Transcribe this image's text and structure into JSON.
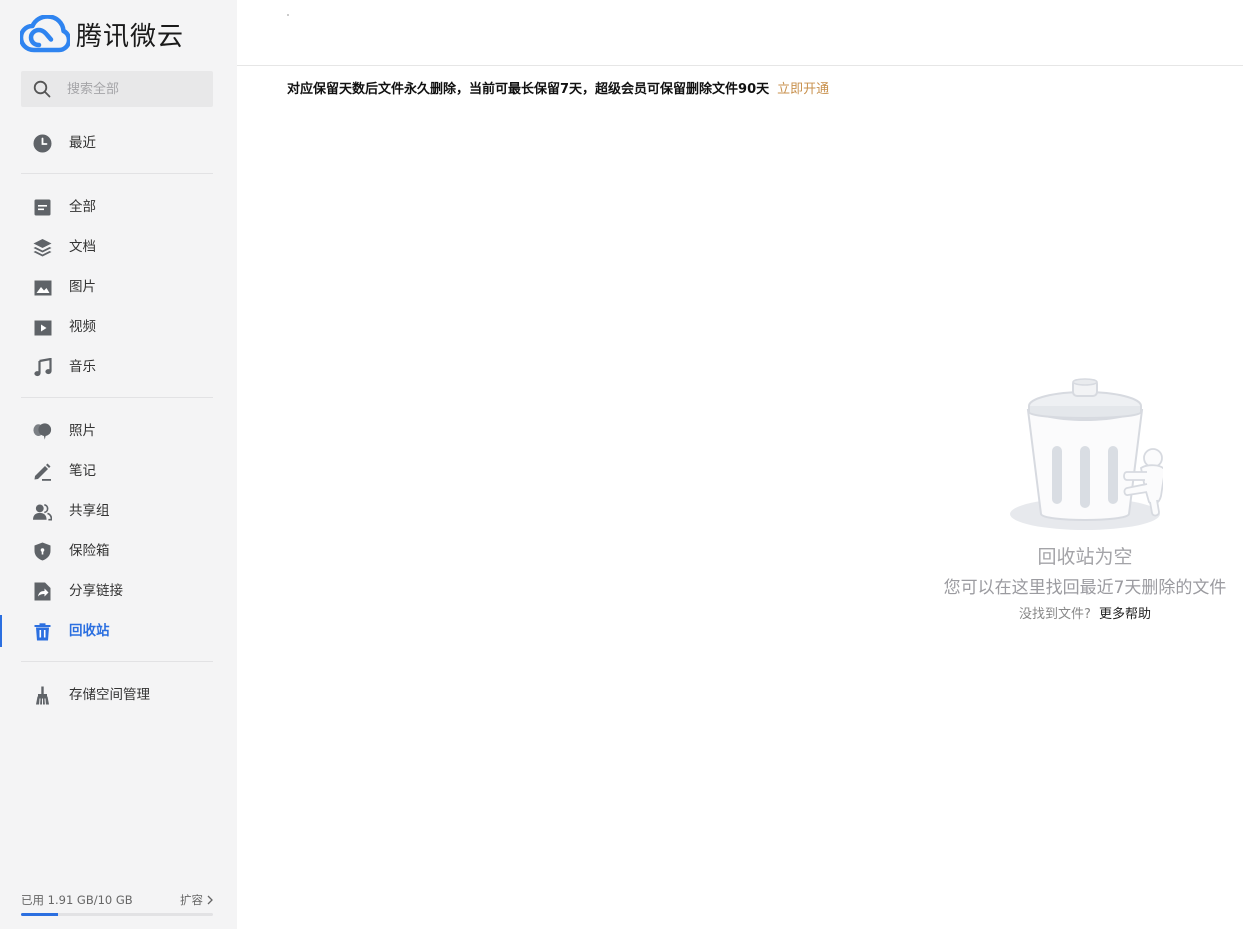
{
  "app": {
    "name": "腾讯微云"
  },
  "search": {
    "placeholder": "搜索全部"
  },
  "nav": {
    "recent": {
      "label": "最近",
      "icon": "clock-icon"
    },
    "all": {
      "label": "全部",
      "icon": "file-icon"
    },
    "docs": {
      "label": "文档",
      "icon": "layers-icon"
    },
    "images": {
      "label": "图片",
      "icon": "image-icon"
    },
    "videos": {
      "label": "视频",
      "icon": "video-icon"
    },
    "music": {
      "label": "音乐",
      "icon": "music-note-icon"
    },
    "photos": {
      "label": "照片",
      "icon": "balloon-icon"
    },
    "notes": {
      "label": "笔记",
      "icon": "pencil-icon"
    },
    "groups": {
      "label": "共享组",
      "icon": "users-icon"
    },
    "safe": {
      "label": "保险箱",
      "icon": "shield-icon"
    },
    "share_links": {
      "label": "分享链接",
      "icon": "share-file-icon"
    },
    "trash": {
      "label": "回收站",
      "icon": "trash-icon",
      "active": true
    },
    "storage_manage": {
      "label": "存储空间管理",
      "icon": "broom-icon"
    }
  },
  "storage": {
    "used_text": "已用 1.91 GB/10 GB",
    "expand_label": "扩容",
    "used_fraction": 0.191
  },
  "notice": {
    "text": "对应保留天数后文件永久删除，当前可最长保留7天，超级会员可保留删除文件90天",
    "link": "立即开通"
  },
  "empty_state": {
    "title": "回收站为空",
    "description": "您可以在这里找回最近7天删除的文件",
    "help_question": "没找到文件?",
    "help_link": "更多帮助"
  },
  "colors": {
    "accent": "#2b6fe0",
    "link_gold": "#c8914e",
    "sidebar_bg": "#f4f4f5",
    "icon_gray": "#5f6368"
  }
}
